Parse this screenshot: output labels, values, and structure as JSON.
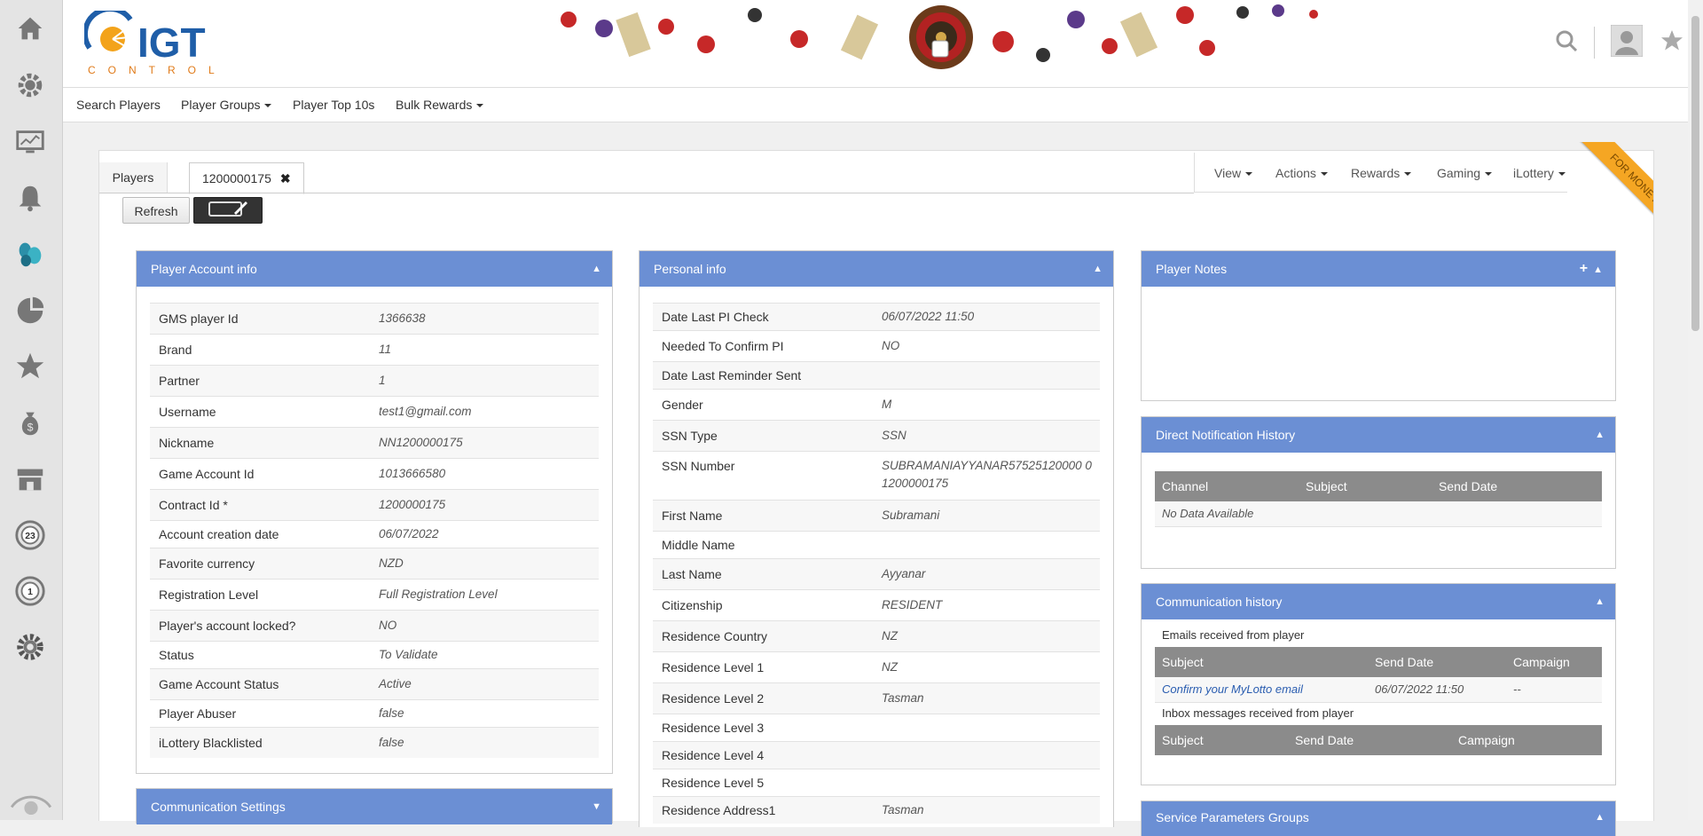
{
  "sidebar": {
    "items": [
      "home-icon",
      "settings-gear-icon",
      "monitor-chart-icon",
      "bell-icon",
      "players-icon",
      "pie-chart-icon",
      "star-icon",
      "money-bag-icon",
      "store-icon",
      "lottery-ball-23-icon",
      "lottery-ball-1-icon",
      "gear-cog-icon",
      "eye-icon"
    ],
    "active_color": "#2b8fa8"
  },
  "header": {
    "logo_text": "IGT",
    "logo_sub": "CONTROL"
  },
  "menu": {
    "search_players": "Search Players",
    "player_groups": "Player Groups",
    "player_top10s": "Player Top 10s",
    "bulk_rewards": "Bulk Rewards"
  },
  "tabs": {
    "players": "Players",
    "player_id": "1200000175"
  },
  "actions": {
    "view": "View",
    "actions": "Actions",
    "rewards": "Rewards",
    "gaming": "Gaming",
    "ilottery": "iLottery",
    "ribbon": "FOR MONEY"
  },
  "buttons": {
    "refresh": "Refresh"
  },
  "account_info": {
    "title": "Player Account info",
    "rows": [
      {
        "label": "GMS player Id",
        "value": "1366638"
      },
      {
        "label": "Brand",
        "value": "11"
      },
      {
        "label": "Partner",
        "value": "1"
      },
      {
        "label": "Username",
        "value": "test1@gmail.com"
      },
      {
        "label": "Nickname",
        "value": "NN1200000175"
      },
      {
        "label": "Game Account Id",
        "value": "1013666580"
      },
      {
        "label": "Contract Id *",
        "value": "1200000175"
      },
      {
        "label": "Account creation date",
        "value": "06/07/2022"
      },
      {
        "label": "Favorite currency",
        "value": "NZD"
      },
      {
        "label": "Registration Level",
        "value": "Full Registration Level"
      },
      {
        "label": "Player's account locked?",
        "value": "NO"
      },
      {
        "label": "Status",
        "value": "To Validate"
      },
      {
        "label": "Game Account Status",
        "value": "Active"
      },
      {
        "label": "Player Abuser",
        "value": "false"
      },
      {
        "label": "iLottery Blacklisted",
        "value": "false"
      }
    ]
  },
  "communication_settings": {
    "title": "Communication Settings"
  },
  "personal_info": {
    "title": "Personal info",
    "rows": [
      {
        "label": "Date Last PI Check",
        "value": "06/07/2022 11:50"
      },
      {
        "label": "Needed To Confirm PI",
        "value": "NO"
      },
      {
        "label": "Date Last Reminder Sent",
        "value": ""
      },
      {
        "label": "Gender",
        "value": "M"
      },
      {
        "label": "SSN Type",
        "value": "SSN"
      },
      {
        "label": "SSN Number",
        "value": "SUBRAMANIAYYANAR57525120000 01200000175"
      },
      {
        "label": "First Name",
        "value": "Subramani"
      },
      {
        "label": "Middle Name",
        "value": ""
      },
      {
        "label": "Last Name",
        "value": "Ayyanar"
      },
      {
        "label": "Citizenship",
        "value": "RESIDENT"
      },
      {
        "label": "Residence Country",
        "value": "NZ"
      },
      {
        "label": "Residence Level 1",
        "value": "NZ"
      },
      {
        "label": "Residence Level 2",
        "value": "Tasman"
      },
      {
        "label": "Residence Level 3",
        "value": ""
      },
      {
        "label": "Residence Level 4",
        "value": ""
      },
      {
        "label": "Residence Level 5",
        "value": ""
      },
      {
        "label": "Residence Address1",
        "value": "Tasman"
      }
    ]
  },
  "player_notes": {
    "title": "Player Notes"
  },
  "direct_notification": {
    "title": "Direct Notification History",
    "columns": [
      "Channel",
      "Subject",
      "Send Date"
    ],
    "empty": "No Data Available"
  },
  "communication_history": {
    "title": "Communication history",
    "emails_caption": "Emails received from player",
    "email_columns": [
      "Subject",
      "Send Date",
      "Campaign"
    ],
    "email_rows": [
      {
        "subject": "Confirm your MyLotto email",
        "send_date": "06/07/2022 11:50",
        "campaign": "--"
      }
    ],
    "inbox_caption": "Inbox messages received from player",
    "inbox_columns": [
      "Subject",
      "Send Date",
      "Campaign"
    ]
  },
  "service_params": {
    "title": "Service Parameters Groups"
  }
}
